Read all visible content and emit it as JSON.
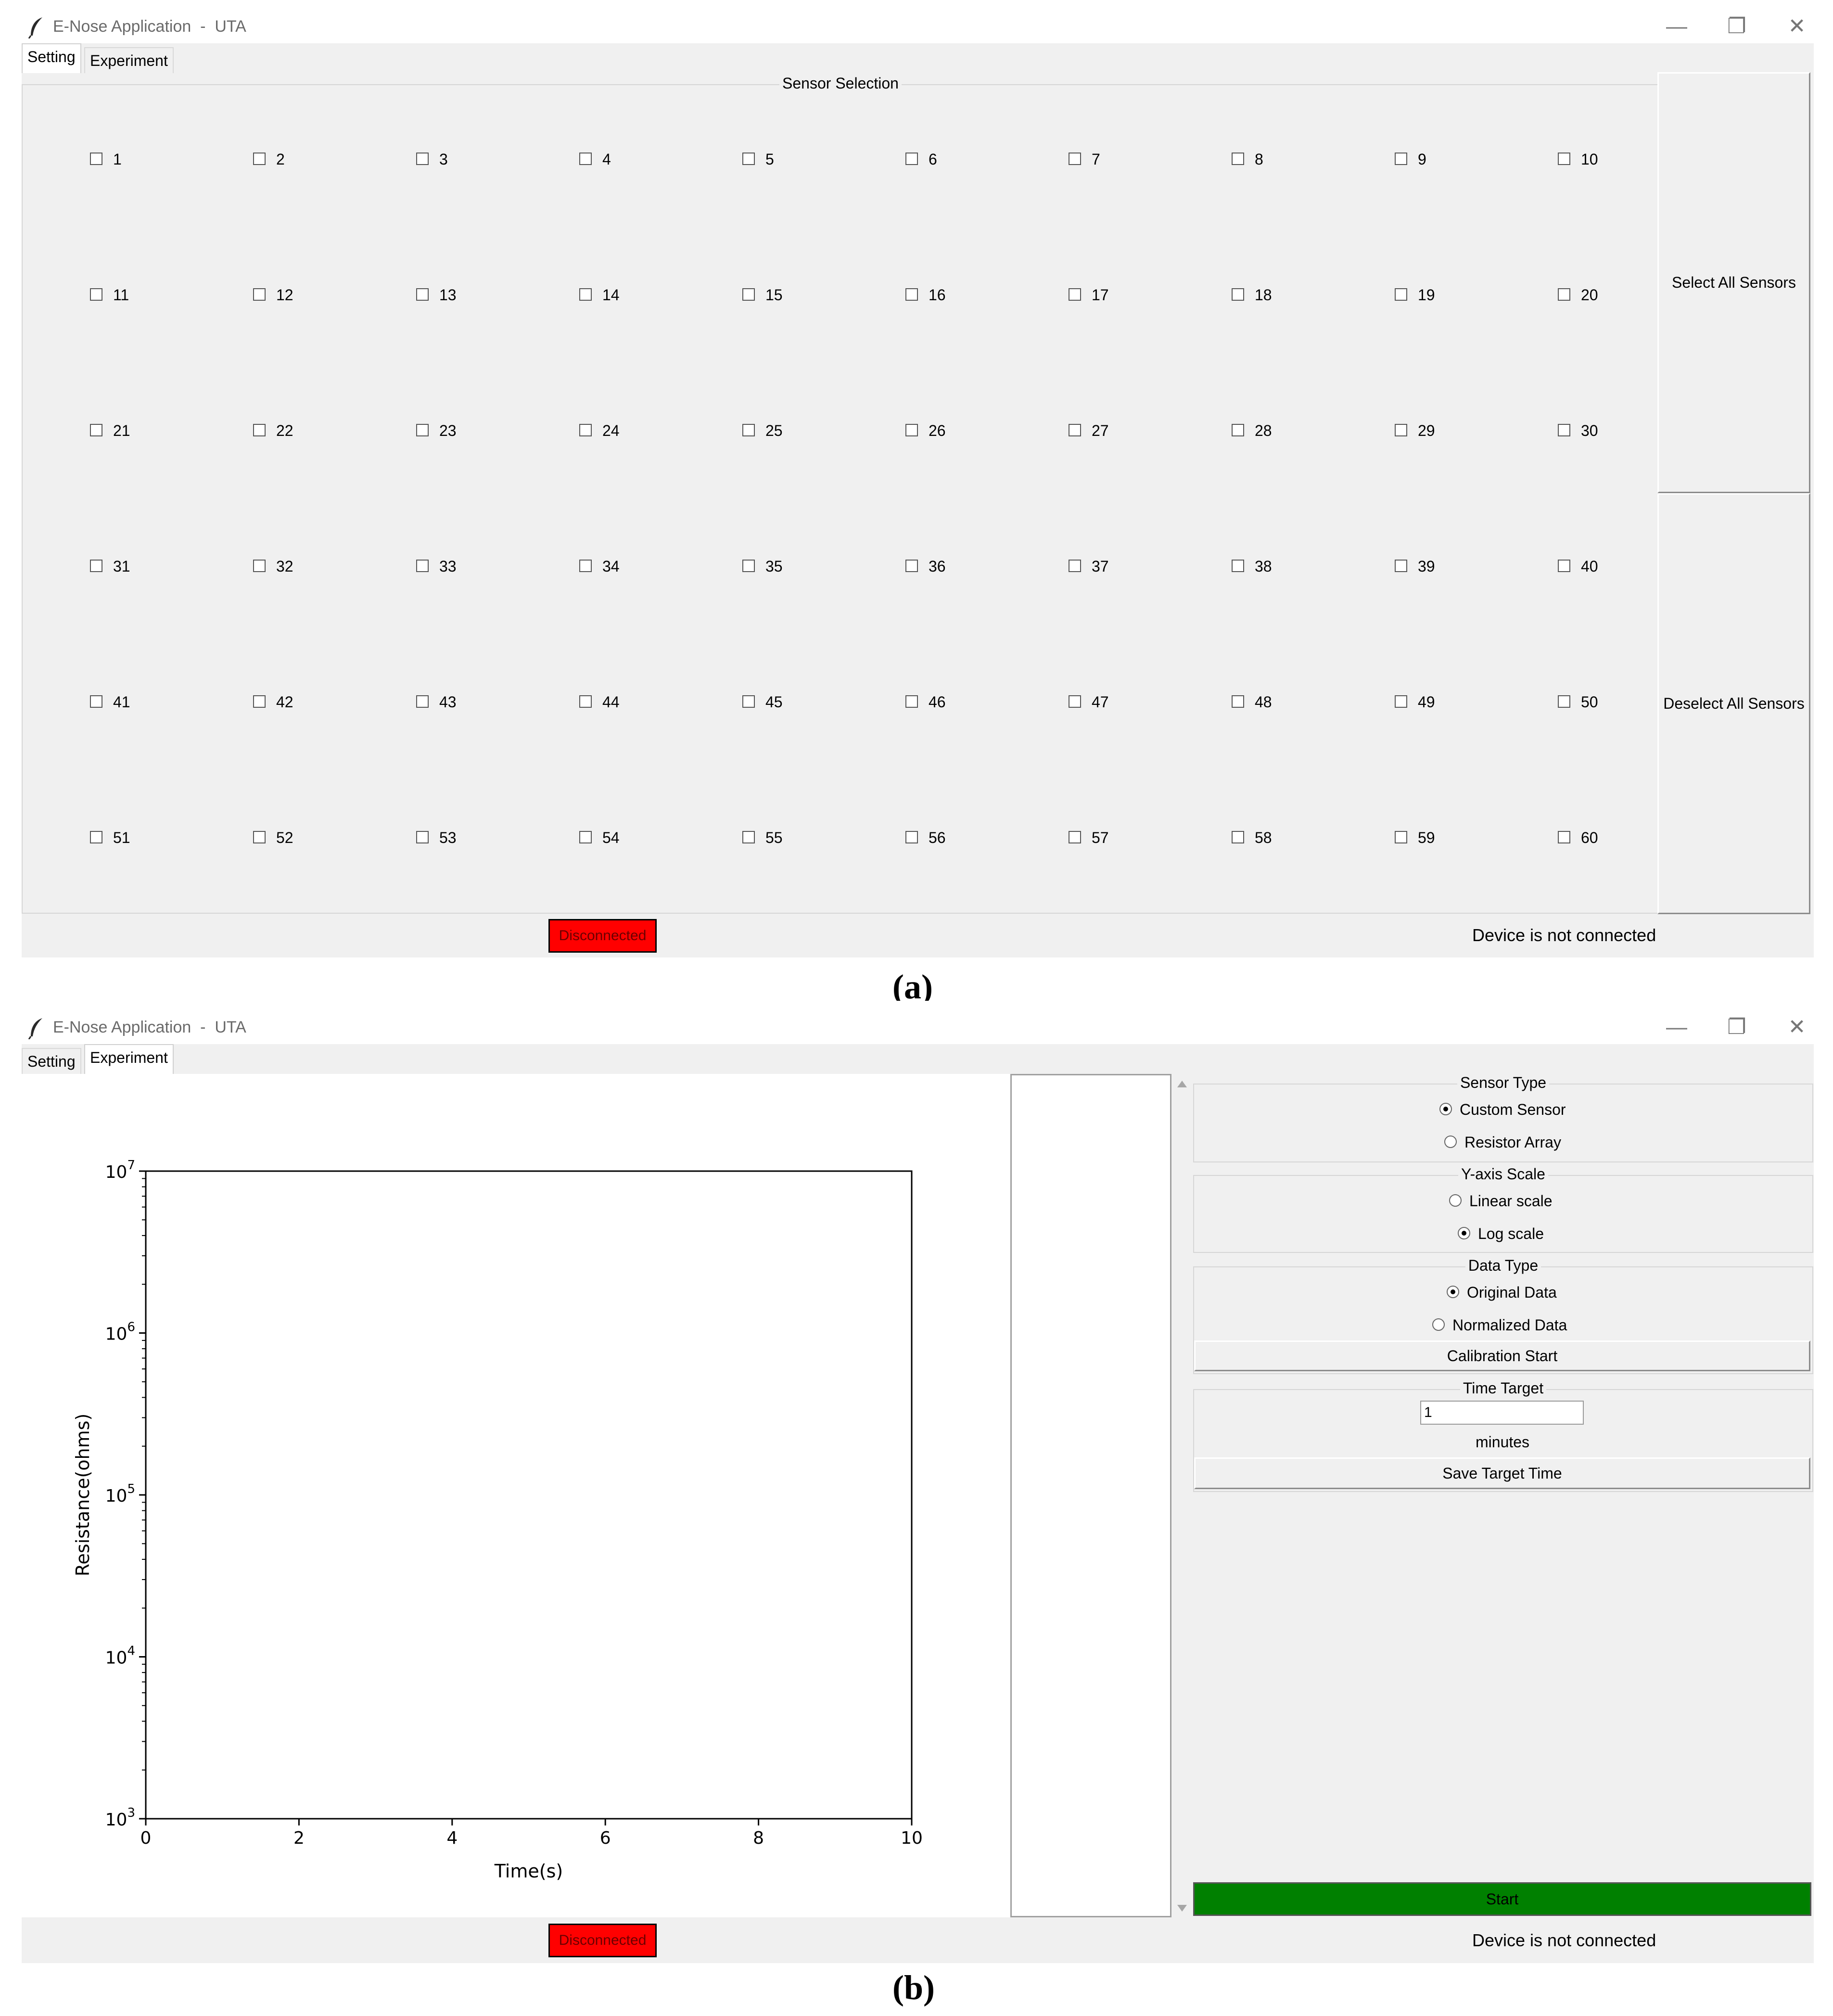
{
  "window": {
    "title": "E-Nose Application  -  UTA",
    "minimize_glyph": "—",
    "restore_glyph": "❐",
    "close_glyph": "✕"
  },
  "tabs": [
    "Setting",
    "Experiment"
  ],
  "setting_panel": {
    "group_title": "Sensor Selection",
    "sensors": [
      "1",
      "2",
      "3",
      "4",
      "5",
      "6",
      "7",
      "8",
      "9",
      "10",
      "11",
      "12",
      "13",
      "14",
      "15",
      "16",
      "17",
      "18",
      "19",
      "20",
      "21",
      "22",
      "23",
      "24",
      "25",
      "26",
      "27",
      "28",
      "29",
      "30",
      "31",
      "32",
      "33",
      "34",
      "35",
      "36",
      "37",
      "38",
      "39",
      "40",
      "41",
      "42",
      "43",
      "44",
      "45",
      "46",
      "47",
      "48",
      "49",
      "50",
      "51",
      "52",
      "53",
      "54",
      "55",
      "56",
      "57",
      "58",
      "59",
      "60"
    ],
    "select_all_label": "Select All Sensors",
    "deselect_all_label": "Deselect All Sensors"
  },
  "status": {
    "indicator": "Disconnected",
    "message": "Device is not connected",
    "indicator_color": "#ff0000"
  },
  "captions": {
    "a": "(a)",
    "b": "(b)"
  },
  "experiment_panel": {
    "sensor_type": {
      "title": "Sensor Type",
      "options": [
        "Custom Sensor",
        "Resistor Array"
      ],
      "selected": "Custom Sensor"
    },
    "y_axis_scale": {
      "title": "Y-axis Scale",
      "options": [
        "Linear scale",
        "Log scale"
      ],
      "selected": "Log scale"
    },
    "data_type": {
      "title": "Data Type",
      "options": [
        "Original Data",
        "Normalized Data"
      ],
      "selected": "Original Data"
    },
    "calibration_button": "Calibration Start",
    "time_target": {
      "title": "Time Target",
      "value": "1",
      "unit": "minutes"
    },
    "save_button": "Save Target Time",
    "start_button": "Start",
    "start_color": "#008000"
  },
  "chart_data": {
    "type": "line",
    "xlabel": "Time(s)",
    "ylabel": "Resistance(ohms)",
    "xlim": [
      0,
      10
    ],
    "ylim": [
      1000,
      10000000
    ],
    "yscale": "log",
    "x_ticks": [
      "0",
      "2",
      "4",
      "6",
      "8",
      "10"
    ],
    "y_ticks": [
      {
        "base": "10",
        "exp": "3"
      },
      {
        "base": "10",
        "exp": "4"
      },
      {
        "base": "10",
        "exp": "5"
      },
      {
        "base": "10",
        "exp": "6"
      },
      {
        "base": "10",
        "exp": "7"
      }
    ],
    "series": [],
    "grid": false
  }
}
